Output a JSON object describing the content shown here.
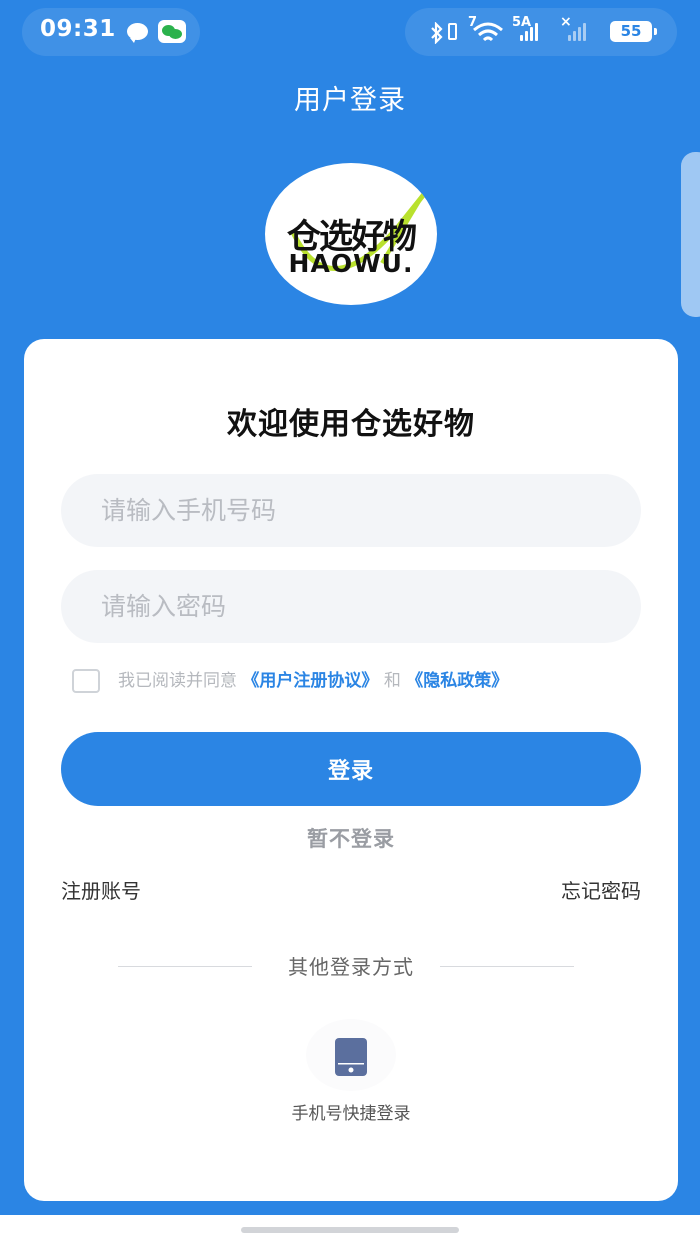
{
  "status_bar": {
    "time": "09:31",
    "network_label": "7",
    "signal_label": "5A",
    "signal2_label": "×",
    "battery": "55"
  },
  "nav": {
    "title": "用户登录"
  },
  "logo": {
    "cn": "仓选好物",
    "en": "HAOWU."
  },
  "card": {
    "welcome": "欢迎使用仓选好物",
    "phone_placeholder": "请输入手机号码",
    "password_placeholder": "请输入密码",
    "agree_prefix": "我已阅读并同意",
    "agree_link_terms": "《用户注册协议》",
    "agree_and": "和",
    "agree_link_privacy": "《隐私政策》",
    "login_label": "登录",
    "skip_label": "暂不登录",
    "register_label": "注册账号",
    "forgot_label": "忘记密码",
    "other_title": "其他登录方式",
    "quick_login_label": "手机号快捷登录"
  },
  "colors": {
    "primary": "#2b85e4",
    "field_bg": "#f3f5f8",
    "phone_icon": "#5b6f9e"
  },
  "icons": [
    "message-icon",
    "wechat-icon",
    "bluetooth-icon",
    "wifi-icon",
    "signal-icon",
    "battery-icon",
    "phone-icon"
  ]
}
